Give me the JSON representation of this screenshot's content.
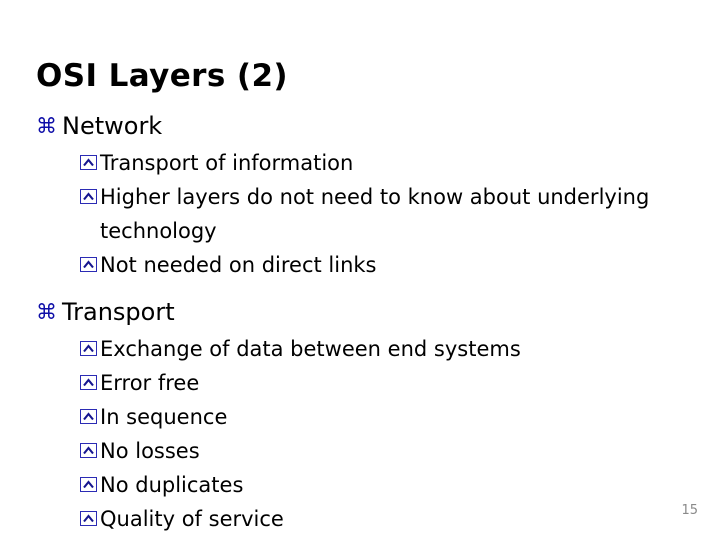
{
  "slide": {
    "title": "OSI Layers (2)",
    "page_number": "15",
    "bullet_level1_icon": "command-bullet-icon",
    "bullet_level2_icon": "square-caret-bullet-icon",
    "colors": {
      "background": "#ffffff",
      "title_text": "#000000",
      "body_text": "#000000",
      "bullet_level1": "#0e0ea8",
      "bullet_level2_border": "#2b2bb4",
      "bullet_level2_caret": "#16168f",
      "page_number": "#8a8a8a"
    },
    "sections": [
      {
        "heading": "Network",
        "items": [
          "Transport of information",
          "Higher layers do not need to know about underlying technology",
          "Not needed on direct links"
        ]
      },
      {
        "heading": "Transport",
        "items": [
          "Exchange of data between end systems",
          "Error free",
          "In sequence",
          "No losses",
          "No duplicates",
          "Quality of service"
        ]
      }
    ]
  }
}
